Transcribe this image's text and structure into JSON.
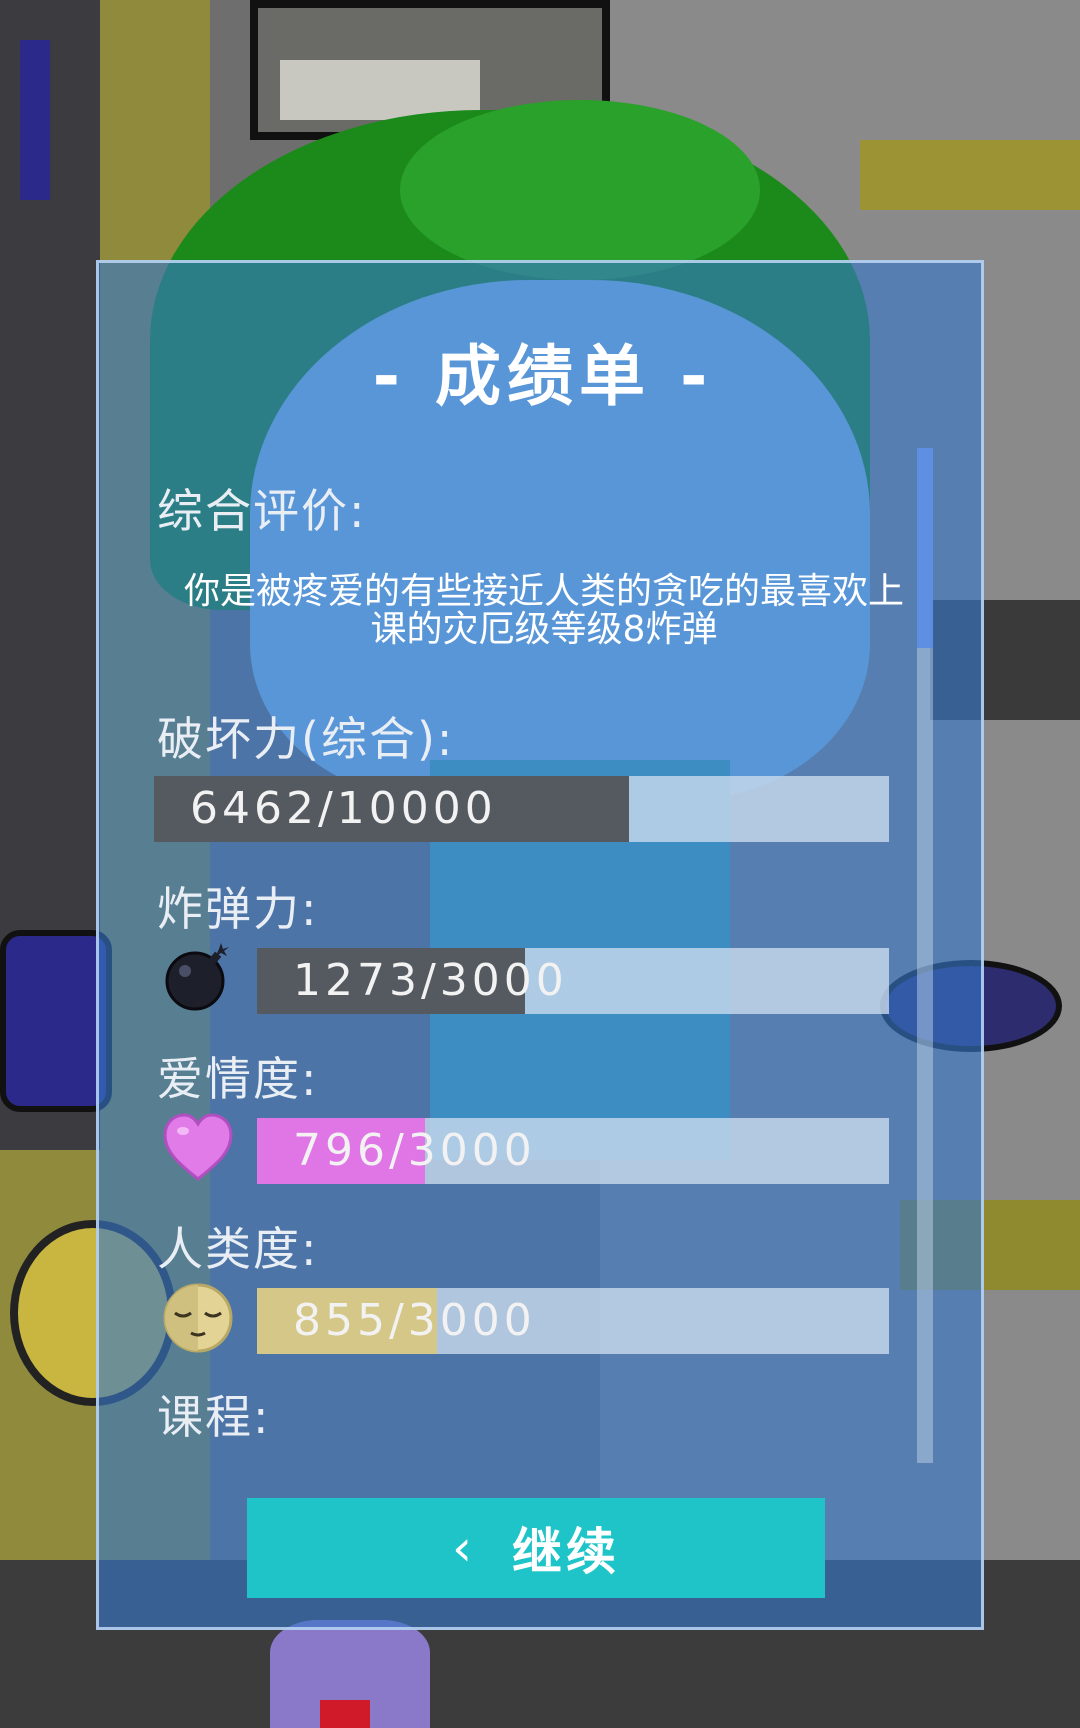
{
  "report": {
    "title": "- 成绩单 -",
    "overall_label": "综合评价:",
    "overall_text": "你是被疼爱的有些接近人类的贪吃的最喜欢上课的灾厄级等级8炸弹",
    "stats": {
      "destruction": {
        "label": "破坏力(综合):",
        "value": 6462,
        "max": 10000,
        "text": "6462/10000",
        "fill_color": "#555a60"
      },
      "bomb": {
        "label": "炸弹力:",
        "icon": "bomb-icon",
        "value": 1273,
        "max": 3000,
        "text": "1273/3000",
        "fill_color": "#555a60"
      },
      "love": {
        "label": "爱情度:",
        "icon": "heart-icon",
        "value": 796,
        "max": 3000,
        "text": "796/3000",
        "fill_color": "#e076e6"
      },
      "human": {
        "label": "人类度:",
        "icon": "sleeping-face-icon",
        "value": 855,
        "max": 3000,
        "text": "855/3000",
        "fill_color": "#d4c788"
      }
    },
    "course_label": "课程:",
    "continue_label": "继续",
    "continue_icon": "chevron-left-icon"
  },
  "colors": {
    "panel_bg": "#3778c8",
    "button_bg": "#1ec4c8",
    "bar_track": "#cddcee"
  }
}
